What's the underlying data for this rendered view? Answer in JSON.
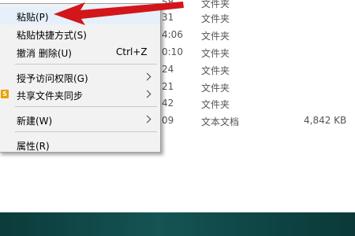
{
  "file_list": {
    "rows": [
      {
        "date": "58",
        "type": "文件夹",
        "size": ""
      },
      {
        "date": "31",
        "type": "文件夹",
        "size": ""
      },
      {
        "date": "4:06",
        "type": "文件夹",
        "size": ""
      },
      {
        "date": "0:10",
        "type": "文件夹",
        "size": ""
      },
      {
        "date": "24",
        "type": "文件夹",
        "size": ""
      },
      {
        "date": "21",
        "type": "文件夹",
        "size": ""
      },
      {
        "date": "42",
        "type": "文件夹",
        "size": ""
      },
      {
        "date": "09",
        "type": "文本文档",
        "size": "4,842 KB"
      }
    ]
  },
  "context_menu": {
    "items": [
      {
        "label": "粘贴(P)",
        "shortcut": ""
      },
      {
        "label": "粘贴快捷方式(S)",
        "shortcut": ""
      },
      {
        "label": "撤消 删除(U)",
        "shortcut": "Ctrl+Z"
      },
      {
        "label": "授予访问权限(G)",
        "shortcut": ""
      },
      {
        "label": "共享文件夹同步",
        "shortcut": ""
      },
      {
        "label": "新建(W)",
        "shortcut": ""
      },
      {
        "label": "属性(R)",
        "shortcut": ""
      }
    ],
    "sync_icon_text": "S"
  },
  "colors": {
    "annotation_arrow": "#d2161a",
    "taskbar": "#124a4a",
    "menu_background": "#f2f2f2"
  }
}
